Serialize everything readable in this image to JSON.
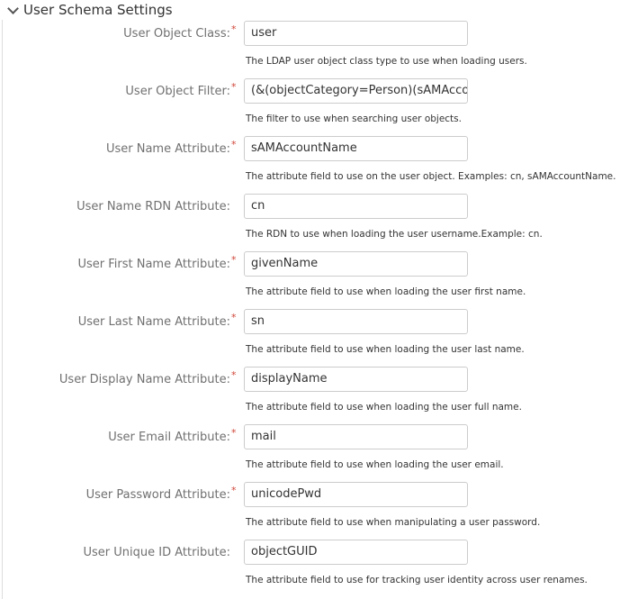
{
  "section": {
    "title": "User Schema Settings"
  },
  "fields": [
    {
      "label": "User Object Class:",
      "required": true,
      "value": "user",
      "help": "The LDAP user object class type to use when loading users."
    },
    {
      "label": "User Object Filter:",
      "required": true,
      "value": "(&(objectCategory=Person)(sAMAccountName=*))",
      "help": "The filter to use when searching user objects."
    },
    {
      "label": "User Name Attribute:",
      "required": true,
      "value": "sAMAccountName",
      "help": "The attribute field to use on the user object. Examples: cn, sAMAccountName."
    },
    {
      "label": "User Name RDN Attribute:",
      "required": false,
      "value": "cn",
      "help": "The RDN to use when loading the user username.Example: cn."
    },
    {
      "label": "User First Name Attribute:",
      "required": true,
      "value": "givenName",
      "help": "The attribute field to use when loading the user first name."
    },
    {
      "label": "User Last Name Attribute:",
      "required": true,
      "value": "sn",
      "help": "The attribute field to use when loading the user last name."
    },
    {
      "label": "User Display Name Attribute:",
      "required": true,
      "value": "displayName",
      "help": "The attribute field to use when loading the user full name."
    },
    {
      "label": "User Email Attribute:",
      "required": true,
      "value": "mail",
      "help": "The attribute field to use when loading the user email."
    },
    {
      "label": "User Password Attribute:",
      "required": true,
      "value": "unicodePwd",
      "help": "The attribute field to use when manipulating a user password."
    },
    {
      "label": "User Unique ID Attribute:",
      "required": false,
      "value": "objectGUID",
      "help": "The attribute field to use for tracking user identity across user renames."
    }
  ],
  "required_mark": "*"
}
